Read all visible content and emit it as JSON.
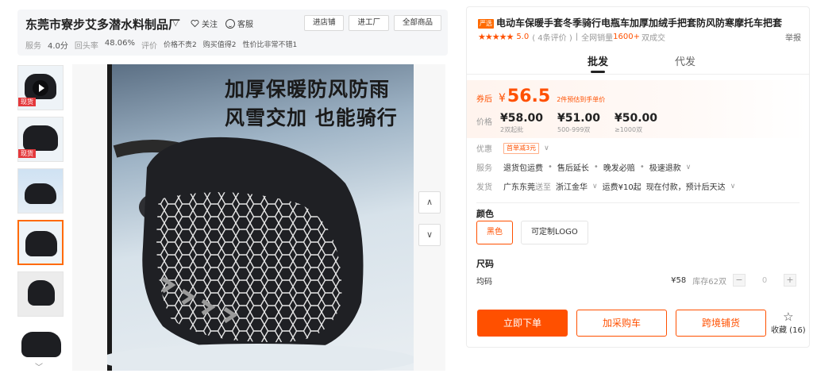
{
  "shop": {
    "name": "东莞市寮步艾多潜水料制品厂",
    "follow": "关注",
    "service": "客服",
    "buttons": [
      "进店铺",
      "进工厂",
      "全部商品"
    ],
    "stats": {
      "service_label": "服务",
      "service_value": "4.0分",
      "repeat_label": "回头率",
      "repeat_value": "48.06%",
      "review_label": "评价",
      "tag1": "价格不贵2",
      "tag2": "购买值得2",
      "tag3": "性价比非常不错1"
    }
  },
  "thumbnails": [
    {
      "label": "现货",
      "video": true
    },
    {
      "label": "现货",
      "video": false
    },
    {
      "label": "",
      "video": false
    },
    {
      "label": "",
      "video": false,
      "active": true
    },
    {
      "label": "",
      "video": false
    },
    {
      "label": "",
      "video": false
    }
  ],
  "main_image": {
    "line1": "加厚保暖防风防雨",
    "line2": "风雪交加 也能骑行"
  },
  "product": {
    "badge": "严选",
    "title": "电动车保暖手套冬季骑行电瓶车加厚加绒手把套防风防寒摩托车把套",
    "stars": "★★★★★",
    "score": "5.0",
    "reviews": "( 4条评价 )",
    "sales_prefix": "全网销量",
    "sales": "1600+",
    "sales_suffix": "双成交",
    "report": "举报"
  },
  "tabs": [
    "批发",
    "代发"
  ],
  "pricing": {
    "coupon_label": "券后",
    "currency": "¥",
    "coupon_price": "56.5",
    "coupon_note": "2件预估到手单价",
    "price_label": "价格",
    "tiers": [
      {
        "price": "¥58.00",
        "qty": "2双起批"
      },
      {
        "price": "¥51.00",
        "qty": "500-999双"
      },
      {
        "price": "¥50.00",
        "qty": "≥1000双"
      }
    ]
  },
  "discount": {
    "label": "优惠",
    "promo": "首单减3元"
  },
  "services": {
    "label": "服务",
    "items": [
      "退货包运费",
      "售后延长",
      "晚发必赔",
      "极速退款"
    ]
  },
  "shipping": {
    "label": "发货",
    "from": "广东东莞",
    "to_word": "送至",
    "to": "浙江金华",
    "fee": "运费¥10起",
    "pay": "现在付款，预计后天达"
  },
  "color": {
    "title": "颜色",
    "options": [
      "黑色",
      "可定制LOGO"
    ]
  },
  "size": {
    "title": "尺码",
    "name": "均码",
    "price": "¥58",
    "stock": "库存62双",
    "minus": "−",
    "qty": "0",
    "plus": "+"
  },
  "actions": {
    "buy": "立即下单",
    "cart": "加采购车",
    "dropship": "跨境铺货",
    "fav": "收藏 (16)"
  },
  "colors": {
    "accent": "#ff5000",
    "hot": "#e4393c"
  }
}
